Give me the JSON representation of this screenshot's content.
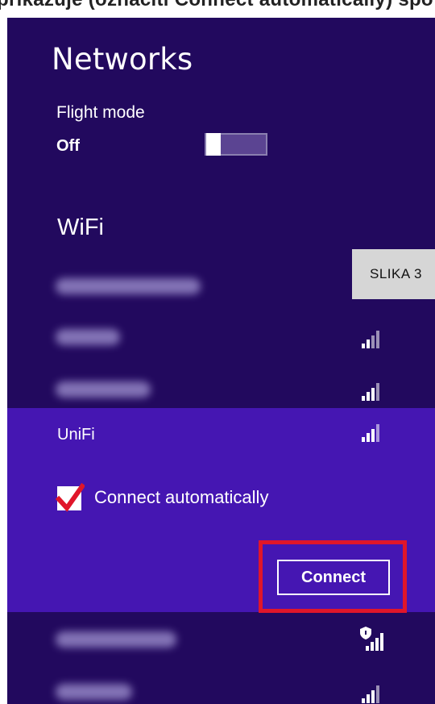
{
  "doc_top_cut": "prikazuje (označiti Connect automatically) spo",
  "title": "Networks",
  "flight_mode": {
    "label": "Flight mode",
    "state": "Off",
    "value": false
  },
  "wifi_heading": "WiFi",
  "networks": [
    {
      "name": "sbb-corp-secure",
      "blurred": true,
      "signal_bars": 0
    },
    {
      "name": "eca2017",
      "blurred": true,
      "signal_bars": 4
    },
    {
      "name": "sbb-public",
      "blurred": true,
      "signal_bars": 4
    },
    {
      "name": "UniFi",
      "blurred": false,
      "signal_bars": 4,
      "selected": true
    },
    {
      "name": "SBB Zona test",
      "blurred": true,
      "signal_bars": 4,
      "secured_shield": true
    },
    {
      "name": "MEDIKA",
      "blurred": true,
      "signal_bars": 4
    }
  ],
  "selected_network": {
    "name": "UniFi",
    "connect_automatically_label": "Connect automatically",
    "connect_automatically_checked": true,
    "connect_button": "Connect"
  },
  "caption_label": "SLIKA 3",
  "colors": {
    "panel_bg": "#22095e",
    "selected_bg": "#4516b2",
    "highlight_box": "#e0162a",
    "caption_bg": "#d6d6d6"
  }
}
